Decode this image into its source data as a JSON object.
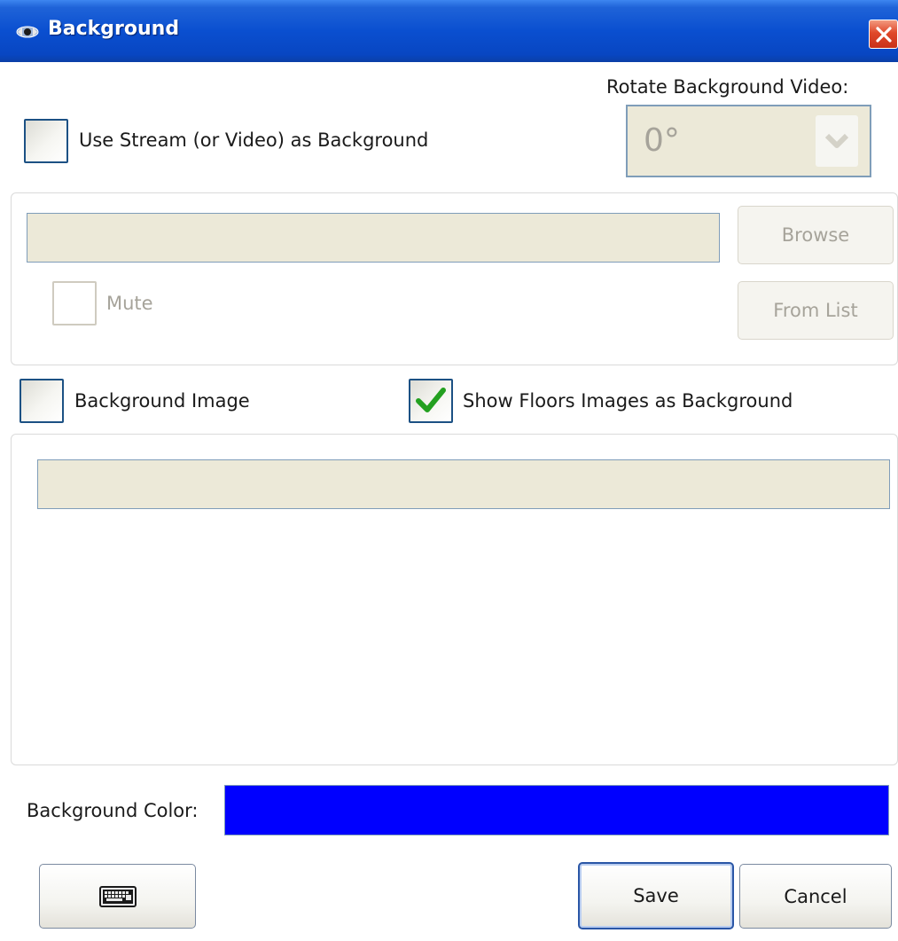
{
  "window": {
    "title": "Background",
    "icon": "eye-icon",
    "close_icon": "close-icon"
  },
  "stream": {
    "use_stream_label": "Use Stream (or Video) as Background",
    "use_stream_checked": false,
    "rotate_label": "Rotate Background Video:",
    "rotate_value": "0°",
    "path_value": "",
    "browse_label": "Browse",
    "from_list_label": "From List",
    "mute_label": "Mute",
    "mute_checked": false
  },
  "image": {
    "background_image_label": "Background Image",
    "background_image_checked": false,
    "show_floors_label": "Show Floors Images as Background",
    "show_floors_checked": true,
    "path_value": ""
  },
  "color": {
    "label": "Background Color:",
    "value": "#0000ff"
  },
  "footer": {
    "keyboard_icon": "keyboard-icon",
    "save_label": "Save",
    "cancel_label": "Cancel"
  }
}
